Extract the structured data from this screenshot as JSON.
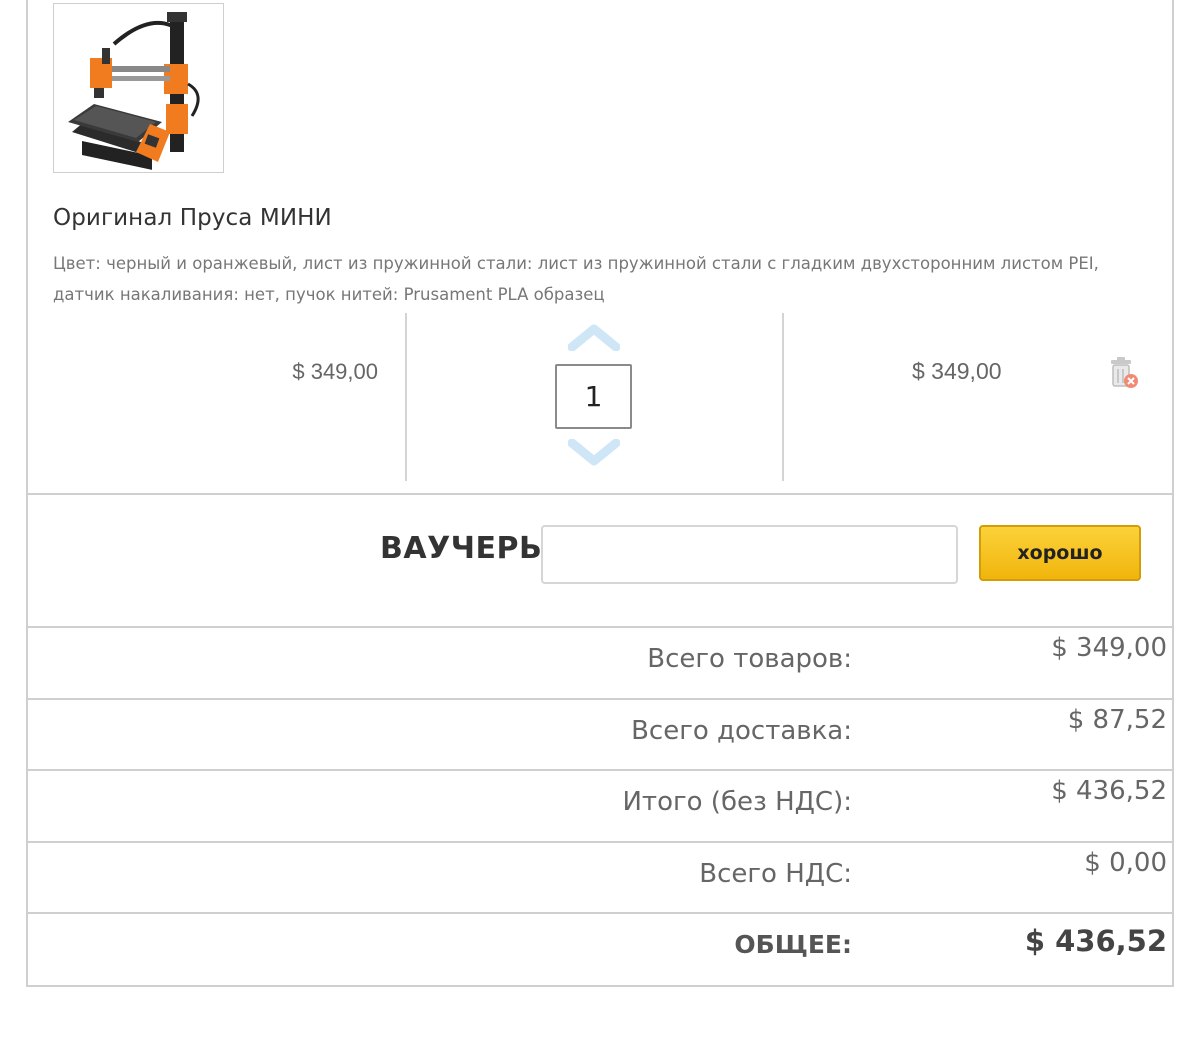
{
  "product": {
    "image_alt": "printer-thumbnail",
    "name": "Оригинал Пруса МИНИ",
    "attributes": "Цвет: черный и оранжевый, лист из пружинной стали: лист из пружинной стали с гладким двухсторонним листом PEI, датчик накаливания: нет, пучок нитей: Prusament PLA образец",
    "unit_price": "$ 349,00",
    "quantity": "1",
    "line_total": "$ 349,00"
  },
  "voucher": {
    "label": "ВАУЧЕРЫ",
    "input_value": "",
    "input_placeholder": "",
    "button_label": "хорошо"
  },
  "summary": [
    {
      "label": "Всего товаров:",
      "value": "$ 349,00"
    },
    {
      "label": "Всего доставка:",
      "value": "$ 87,52"
    },
    {
      "label": "Итого (без НДС):",
      "value": "$ 436,52"
    },
    {
      "label": "Всего НДС:",
      "value": "$ 0,00"
    },
    {
      "label": "ОБЩЕЕ:",
      "value": "$ 436,52"
    }
  ],
  "colors": {
    "accent_button": "#f5c21b",
    "qty_arrow": "#cfe6f7",
    "border": "#cfcfcf",
    "remove_icon_red": "#e0503a"
  },
  "icons": {
    "qty_up": "chevron-up-icon",
    "qty_down": "chevron-down-icon",
    "remove": "trash-remove-icon"
  }
}
